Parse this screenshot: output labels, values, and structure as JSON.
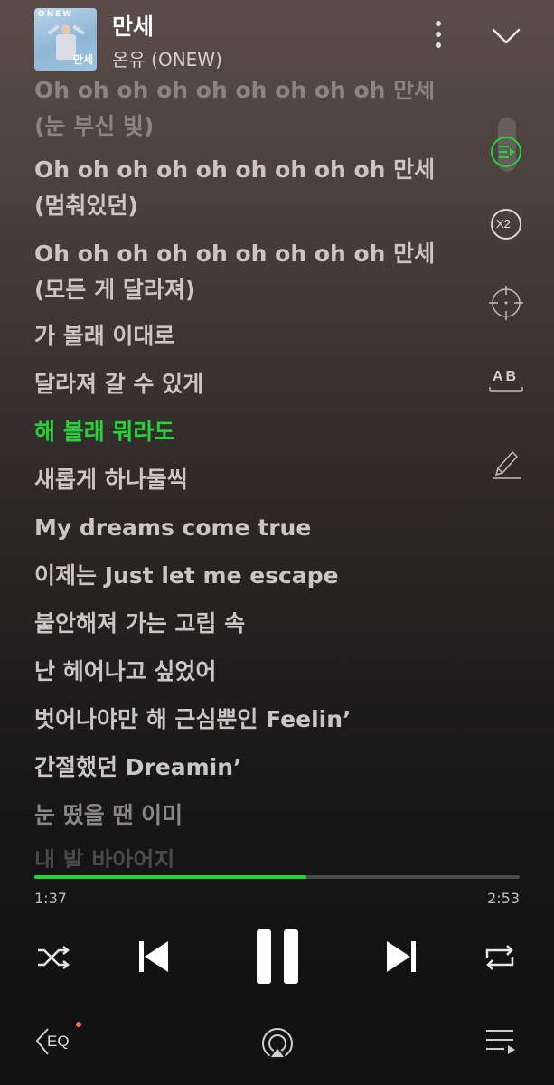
{
  "player": {
    "song_title": "만세",
    "artist": "온유 (ONEW)",
    "cover": {
      "brand_text": "ONEW",
      "tag_text": "만세"
    },
    "lyrics": [
      {
        "text": "Oh oh oh oh oh oh oh oh oh 만세 (눈 부신 빛)",
        "state": "faded-top"
      },
      {
        "text": "Oh oh oh oh oh oh oh oh oh 만세 (멈춰있던)",
        "state": "normal"
      },
      {
        "text": "Oh oh oh oh oh oh oh oh oh 만세 (모든 게 달라져)",
        "state": "normal"
      },
      {
        "text": "가 볼래 이대로",
        "state": "normal"
      },
      {
        "text": "달라져 갈 수 있게",
        "state": "normal"
      },
      {
        "text": "해 볼래 뭐라도",
        "state": "active"
      },
      {
        "text": "새롭게 하나둘씩",
        "state": "normal"
      },
      {
        "text": "My dreams come true",
        "state": "normal"
      },
      {
        "text": "이제는 Just let me escape",
        "state": "normal"
      },
      {
        "text": "불안해져 가는 고립 속",
        "state": "normal"
      },
      {
        "text": "난 헤어나고 싶었어",
        "state": "normal"
      },
      {
        "text": "벗어나야만 해 근심뿐인 Feelin’",
        "state": "normal"
      },
      {
        "text": "간절했던 Dreamin’",
        "state": "normal"
      },
      {
        "text": "눈 떴을 땐 이미",
        "state": "fade1"
      },
      {
        "text": "내 발 바아어지",
        "state": "fade2"
      }
    ],
    "side_tools": [
      {
        "icon": "lyrics-sync-icon",
        "label": ""
      },
      {
        "icon": "speed-x2-icon",
        "label": "X2"
      },
      {
        "icon": "crosshair-icon",
        "label": ""
      },
      {
        "icon": "translate-ab-icon",
        "label": "AB"
      },
      {
        "icon": "pen-icon",
        "label": ""
      }
    ],
    "progress": {
      "current": "1:37",
      "total": "2:53",
      "fraction": 0.56
    },
    "colors": {
      "accent": "#26d238",
      "notification": "#ff6a3d"
    },
    "controls": [
      "shuffle-icon",
      "previous-icon",
      "pause-icon",
      "next-icon",
      "repeat-icon"
    ],
    "bottom_bar": {
      "eq_label": "EQ",
      "items": [
        "eq-icon",
        "airplay-icon",
        "queue-icon"
      ]
    }
  }
}
